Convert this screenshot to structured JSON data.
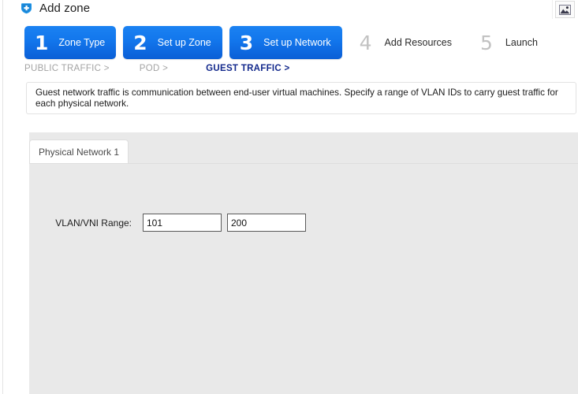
{
  "window": {
    "title": "Add zone",
    "title_icon": "add-zone-shield-icon",
    "top_right_icon": "image-placeholder-icon"
  },
  "wizard": {
    "steps": [
      {
        "number": "1",
        "label": "Zone Type",
        "state": "active"
      },
      {
        "number": "2",
        "label": "Set up Zone",
        "state": "active"
      },
      {
        "number": "3",
        "label": "Set up Network",
        "state": "active"
      },
      {
        "number": "4",
        "label": "Add Resources",
        "state": "inactive"
      },
      {
        "number": "5",
        "label": "Launch",
        "state": "inactive"
      }
    ],
    "active_color": "#1276ec",
    "inactive_number_color": "#c2c2c2"
  },
  "breadcrumb": {
    "items": [
      {
        "label": "PUBLIC TRAFFIC >",
        "state": "done"
      },
      {
        "label": "POD >",
        "state": "done"
      },
      {
        "label": "GUEST TRAFFIC >",
        "state": "current"
      }
    ],
    "current_color": "#13298c",
    "done_color": "#a3a3a3"
  },
  "description": {
    "text": "Guest network traffic is communication between end-user virtual machines. Specify a range of VLAN IDs to carry guest traffic for each physical network."
  },
  "tabs": [
    {
      "label": "Physical Network 1",
      "state": "active"
    }
  ],
  "form": {
    "vlan_range": {
      "label": "VLAN/VNI Range:",
      "start_value": "101",
      "end_value": "200",
      "start_placeholder": "",
      "end_placeholder": ""
    }
  }
}
